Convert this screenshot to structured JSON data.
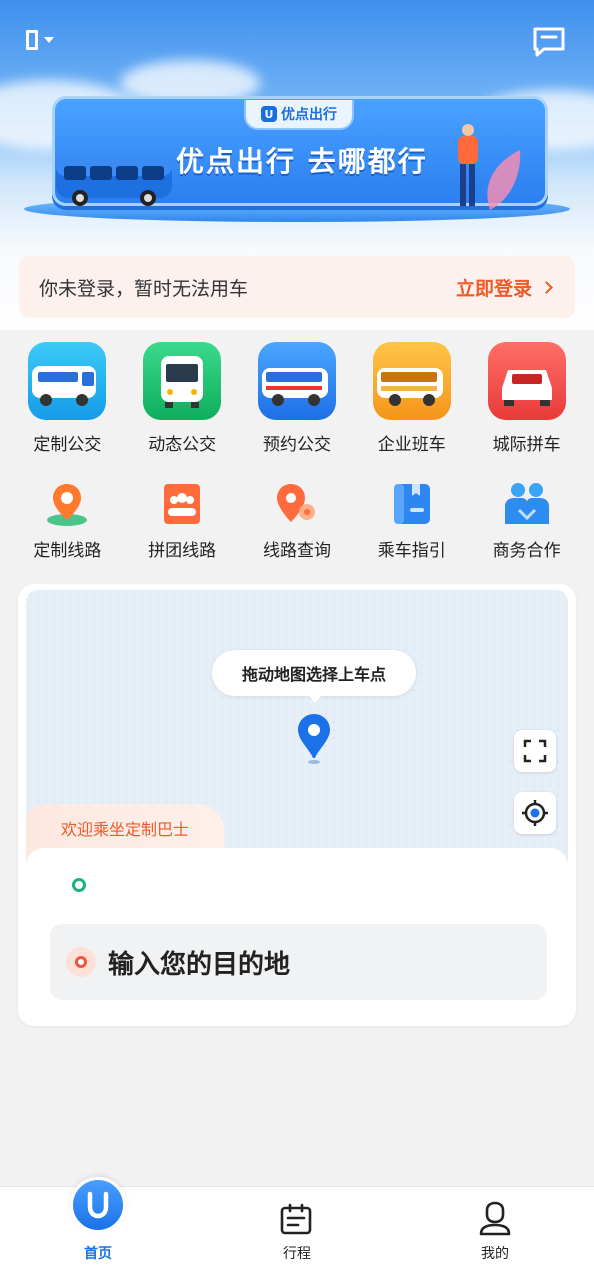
{
  "header": {
    "city_icon": "bracket-icon",
    "message_icon": "message-icon"
  },
  "banner": {
    "brand": "优点出行",
    "slogan": "优点出行 去哪都行"
  },
  "login_notice": {
    "message": "你未登录，暂时无法用车",
    "action": "立即登录"
  },
  "services": [
    {
      "label": "定制公交",
      "icon": "bus-icon",
      "color": "#1fb0f0"
    },
    {
      "label": "动态公交",
      "icon": "bus-front-icon",
      "color": "#19c06e"
    },
    {
      "label": "预约公交",
      "icon": "coach-icon",
      "color": "#2e7ff0"
    },
    {
      "label": "企业班车",
      "icon": "shuttle-icon",
      "color": "#f6a52c"
    },
    {
      "label": "城际拼车",
      "icon": "car-icon",
      "color": "#f24e48"
    }
  ],
  "tools": [
    {
      "label": "定制线路",
      "icon": "location-pin-icon"
    },
    {
      "label": "拼团线路",
      "icon": "group-icon"
    },
    {
      "label": "线路查询",
      "icon": "route-search-icon"
    },
    {
      "label": "乘车指引",
      "icon": "guide-book-icon"
    },
    {
      "label": "商务合作",
      "icon": "partners-icon"
    }
  ],
  "map": {
    "tooltip": "拖动地图选择上车点",
    "welcome": "欢迎乘坐定制巴士",
    "destination_placeholder": "输入您的目的地",
    "fullscreen_icon": "fullscreen-icon",
    "locate_icon": "locate-icon"
  },
  "tabs": [
    {
      "label": "首页",
      "icon": "home-logo-icon",
      "active": true
    },
    {
      "label": "行程",
      "icon": "trip-icon",
      "active": false
    },
    {
      "label": "我的",
      "icon": "profile-icon",
      "active": false
    }
  ],
  "colors": {
    "primary": "#1b72e8",
    "accent": "#f05a28",
    "start_green": "#19b37d"
  }
}
